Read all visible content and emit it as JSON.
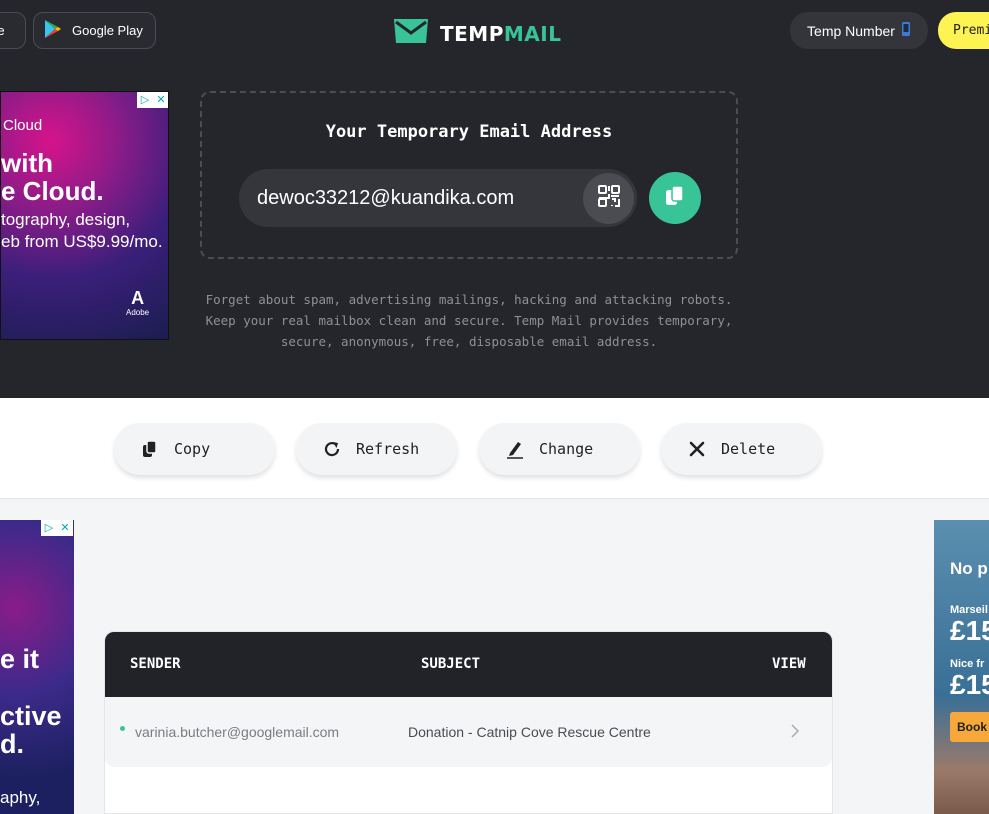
{
  "header": {
    "store_left_label": "re",
    "google_play_label": "Google Play",
    "logo_temp": "TEMP",
    "logo_mail": "MAIL",
    "temp_number_label": "Temp Number",
    "premium_label": "Premi"
  },
  "ad_top": {
    "line1": "Cloud",
    "line2a": " with",
    "line2b": "e Cloud.",
    "line3a": "tography, design,",
    "line3b": "eb from US$9.99/mo.",
    "brand": "Adobe"
  },
  "email": {
    "title": "Your Temporary Email Address",
    "address": "dewoc33212@kuandika.com"
  },
  "description": {
    "line1": "Forget about spam, advertising mailings, hacking and attacking robots.",
    "line2": "Keep your real mailbox clean and secure. Temp Mail provides temporary,",
    "line3": "secure, anonymous, free, disposable email address."
  },
  "actions": {
    "copy": "Copy",
    "refresh": "Refresh",
    "change": "Change",
    "delete": "Delete"
  },
  "ad_left": {
    "line1": "e it",
    "line2": "ctive",
    "line3": "d.",
    "line4": "aphy,"
  },
  "ad_right": {
    "headline": "No p the d",
    "city1": "Marseil",
    "price1": "£15",
    "city2": "Nice fr",
    "price2": "£15",
    "cta": "Book"
  },
  "inbox": {
    "columns": {
      "sender": "SENDER",
      "subject": "SUBJECT",
      "view": "VIEW"
    },
    "rows": [
      {
        "sender": "varinia.butcher@googlemail.com",
        "subject": "Donation - Catnip Cove Rescue Centre",
        "unread": true
      }
    ]
  },
  "colors": {
    "hero_bg": "#25262b",
    "accent_green": "#39c498",
    "premium_yellow": "#fdf353"
  }
}
